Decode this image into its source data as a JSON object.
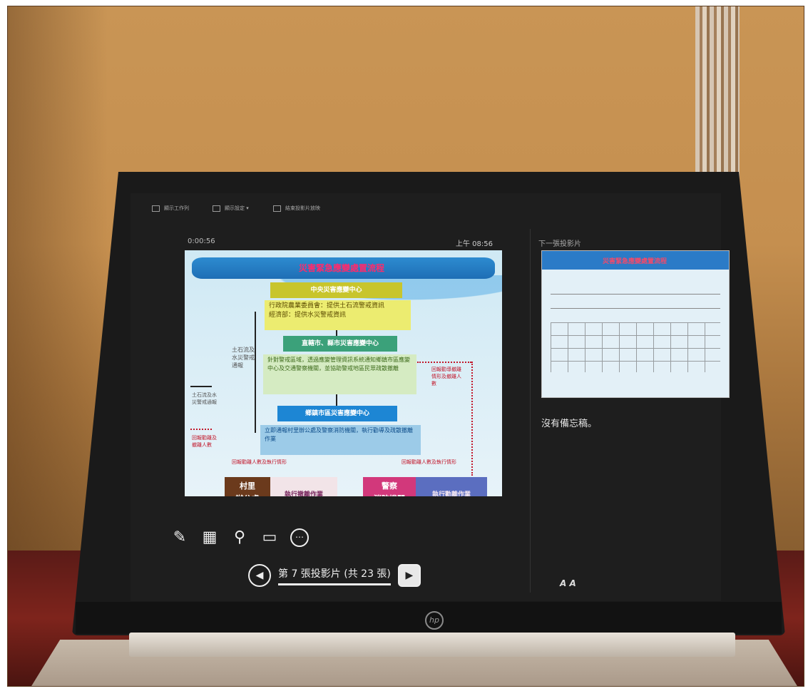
{
  "topbar": {
    "items": [
      {
        "label": "顯示工作列",
        "icon": "taskbar-icon"
      },
      {
        "label": "顯示設定 ▾",
        "icon": "display-settings-icon"
      },
      {
        "label": "結束投影片放映",
        "icon": "end-show-icon"
      }
    ]
  },
  "timer": "0:00:56",
  "clock": "上午 08:56",
  "slide": {
    "title": "災害緊急應變處置流程",
    "central_center": "中央災害應變中心",
    "central_body": "行政院農業委員會：提供土石流警戒資訊\n經濟部：提供水災警戒資訊",
    "county_center": "直轄市、縣市災害應變中心",
    "county_body": "針對警戒區域，透過應變管理資訊系統通知鄉鎮市區應變中心及交通警察機關，並協助警戒地區民眾疏散撤離",
    "township_center": "鄉鎮市區災害應變中心",
    "township_body": "立即通報村里辦公處及警察消防機關，執行勸導及疏散撤離作業",
    "side_note": "土石流及水災警戒通報",
    "legend_black": "土石流及水災警戒通報",
    "legend_red": "回報勸離及撤離人數",
    "right_note": "回報勸導撤離情形及撤離人數",
    "red_note_left": "回報勸離人數及執行情形",
    "red_note_right": "回報勸離人數及執行情形",
    "village": "村里\n辦公處",
    "village_exec": "執行撤離作業",
    "police": "警察\n消防機關",
    "police_exec": "執行勸離作業"
  },
  "tools": [
    {
      "name": "pen-tool-icon",
      "glyph": "✎"
    },
    {
      "name": "see-all-slides-icon",
      "glyph": "▦"
    },
    {
      "name": "zoom-icon",
      "glyph": "⚲"
    },
    {
      "name": "black-screen-icon",
      "glyph": "▭"
    },
    {
      "name": "more-options-icon",
      "glyph": "⋯"
    }
  ],
  "navigation": {
    "label": "第 7 張投影片 (共 23 張)",
    "prev_glyph": "◀",
    "next_glyph": "▶"
  },
  "next_slide": {
    "label": "下一張投影片",
    "title": "災害緊急應變處置流程"
  },
  "notes": "沒有備忘稿。",
  "font_buttons": "A A",
  "brand": "hp"
}
